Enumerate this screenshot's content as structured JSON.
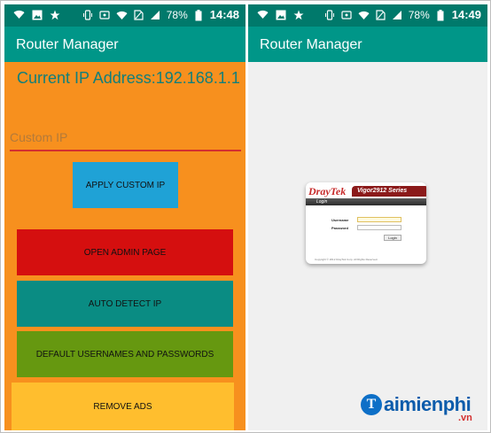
{
  "left_phone": {
    "status": {
      "battery": "78%",
      "time": "14:48"
    },
    "app_title": "Router Manager",
    "ip_label": "Current IP Address:",
    "ip_value": "192.168.1.1",
    "custom_ip_placeholder": "Custom IP",
    "custom_ip_value": "",
    "buttons": {
      "apply": "APPLY CUSTOM IP",
      "admin": "OPEN ADMIN PAGE",
      "auto": "AUTO DETECT IP",
      "defaults": "DEFAULT USERNAMES AND PASSWORDS",
      "ads": "REMOVE ADS"
    },
    "colors": {
      "background": "#f7901e",
      "apply": "#1fa2d6",
      "admin": "#d50f0f",
      "auto": "#0a8c83",
      "defaults": "#669810",
      "ads": "#ffbe2e"
    }
  },
  "right_phone": {
    "status": {
      "battery": "78%",
      "time": "14:49"
    },
    "app_title": "Router Manager",
    "router_page": {
      "brand": "DrayTek",
      "model": "Vigor2912 Series",
      "tab": "Login",
      "username_label": "Username",
      "password_label": "Password",
      "login_button": "Login",
      "footer": "Copyright © 2012 DrayTek Corp. All Rights Reserved."
    }
  },
  "icons": [
    "wifi-icon",
    "image-icon",
    "star-icon",
    "vibrate-icon",
    "cast-icon",
    "wifi-signal-icon",
    "no-sim-icon",
    "cell-signal-icon",
    "battery-icon"
  ],
  "theme": {
    "statusbar": "#00796b",
    "appbar": "#009688"
  },
  "watermark": {
    "brand": "aimienphi",
    "suffix": ".vn"
  }
}
